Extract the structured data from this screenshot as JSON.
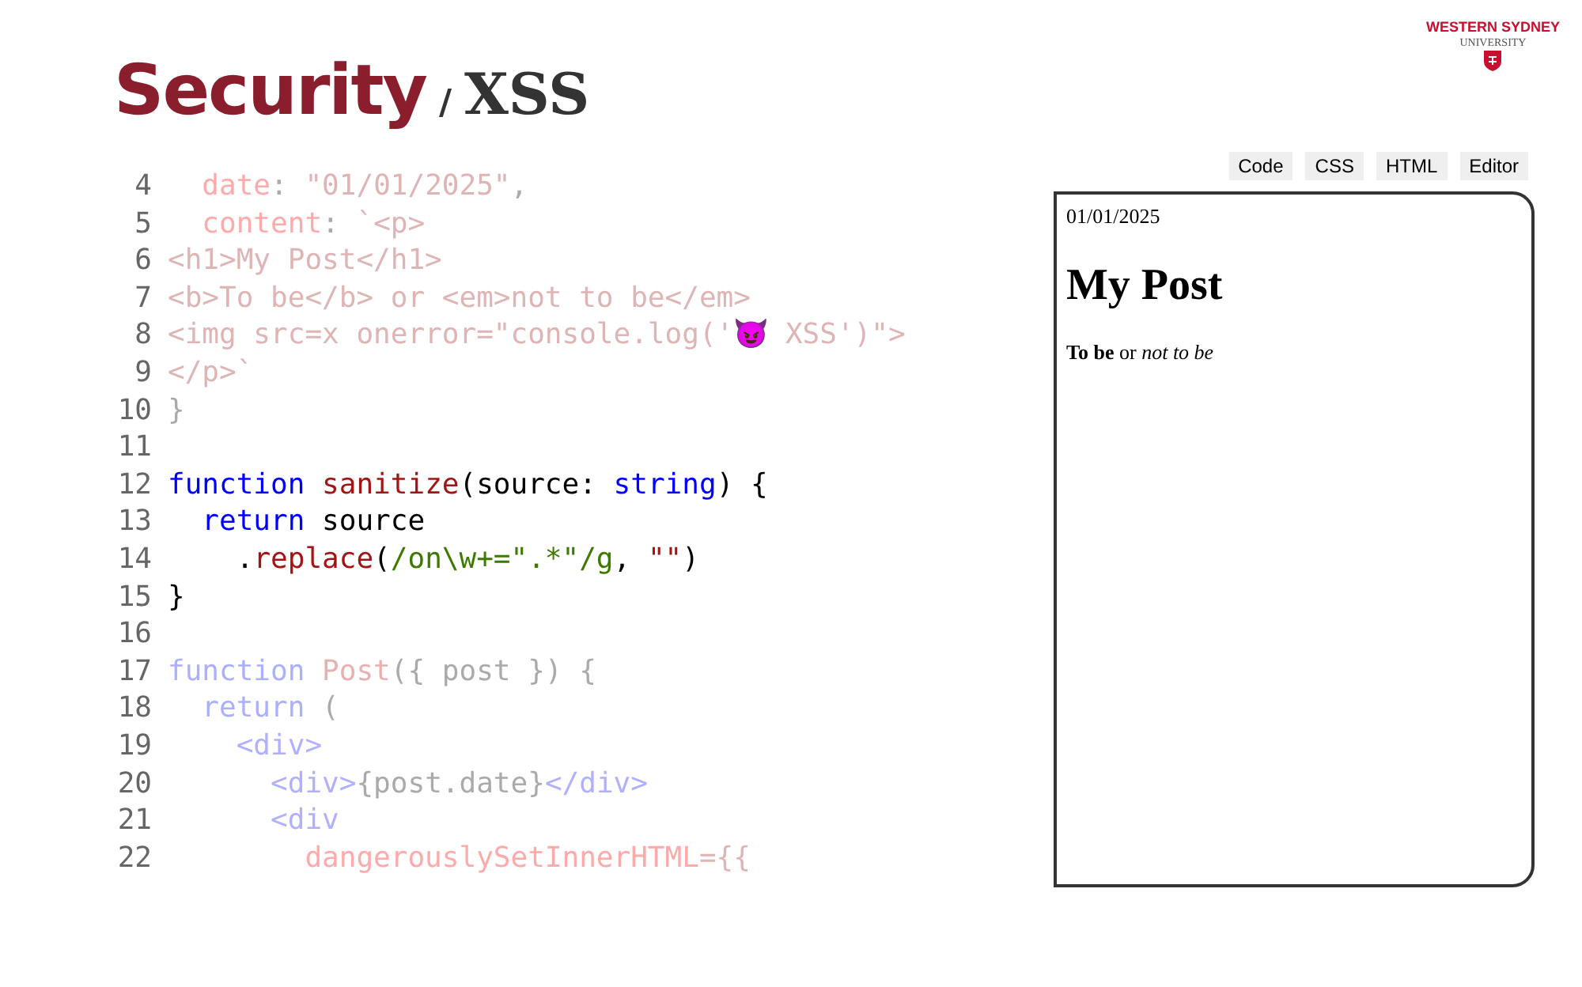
{
  "logo": {
    "line1": "WESTERN SYDNEY",
    "line2": "UNIVERSITY"
  },
  "title": {
    "main": "Security",
    "separator": "/",
    "sub": "XSS"
  },
  "code": {
    "lines": [
      {
        "number": "4",
        "dimmed": true,
        "tokens": [
          {
            "text": "  date",
            "kind": "prop"
          },
          {
            "text": ": ",
            "kind": "plain"
          },
          {
            "text": "\"01/01/2025\"",
            "kind": "template"
          },
          {
            "text": ",",
            "kind": "plain"
          }
        ]
      },
      {
        "number": "5",
        "dimmed": true,
        "tokens": [
          {
            "text": "  content",
            "kind": "prop"
          },
          {
            "text": ": ",
            "kind": "plain"
          },
          {
            "text": "`<p>",
            "kind": "template"
          }
        ]
      },
      {
        "number": "6",
        "dimmed": true,
        "tokens": [
          {
            "text": "<h1>My Post</h1>",
            "kind": "template"
          }
        ]
      },
      {
        "number": "7",
        "dimmed": true,
        "tokens": [
          {
            "text": "<b>To be</b> or <em>not to be</em>",
            "kind": "template"
          }
        ]
      },
      {
        "number": "8",
        "dimmed": true,
        "tokens": [
          {
            "text": "<img src=x onerror=\"console.log('😈 XSS')\">",
            "kind": "template"
          }
        ]
      },
      {
        "number": "9",
        "dimmed": true,
        "tokens": [
          {
            "text": "</p>`",
            "kind": "template"
          }
        ]
      },
      {
        "number": "10",
        "dimmed": true,
        "tokens": [
          {
            "text": "}",
            "kind": "plain"
          }
        ]
      },
      {
        "number": "11"
      },
      {
        "number": "12",
        "dimmed": false,
        "tokens": [
          {
            "text": "function ",
            "kind": "keyword"
          },
          {
            "text": "sanitize",
            "kind": "fn"
          },
          {
            "text": "(source: ",
            "kind": "plain"
          },
          {
            "text": "string",
            "kind": "keyword"
          },
          {
            "text": ") {",
            "kind": "plain"
          }
        ]
      },
      {
        "number": "13",
        "dimmed": false,
        "tokens": [
          {
            "text": "  return",
            "kind": "keyword"
          },
          {
            "text": " source",
            "kind": "plain"
          }
        ]
      },
      {
        "number": "14",
        "dimmed": false,
        "tokens": [
          {
            "text": "    .",
            "kind": "plain"
          },
          {
            "text": "replace",
            "kind": "fn"
          },
          {
            "text": "(",
            "kind": "plain"
          },
          {
            "text": "/on\\w+=\".*\"/g",
            "kind": "regex"
          },
          {
            "text": ", ",
            "kind": "plain"
          },
          {
            "text": "\"\"",
            "kind": "string"
          },
          {
            "text": ")",
            "kind": "plain"
          }
        ]
      },
      {
        "number": "15",
        "dimmed": false,
        "tokens": [
          {
            "text": "}",
            "kind": "plain"
          }
        ]
      },
      {
        "number": "16"
      },
      {
        "number": "17",
        "dimmed": true,
        "tokens": [
          {
            "text": "function ",
            "kind": "keyword"
          },
          {
            "text": "Post",
            "kind": "fn"
          },
          {
            "text": "({ post }) {",
            "kind": "plain"
          }
        ]
      },
      {
        "number": "18",
        "dimmed": true,
        "tokens": [
          {
            "text": "  return",
            "kind": "keyword"
          },
          {
            "text": " (",
            "kind": "plain"
          }
        ]
      },
      {
        "number": "19",
        "dimmed": true,
        "tokens": [
          {
            "text": "    <div>",
            "kind": "tag"
          }
        ]
      },
      {
        "number": "20",
        "dimmed": true,
        "tokens": [
          {
            "text": "      <div>",
            "kind": "tag"
          },
          {
            "text": "{post.date}",
            "kind": "plain"
          },
          {
            "text": "</div>",
            "kind": "tag"
          }
        ]
      },
      {
        "number": "21",
        "dimmed": true,
        "tokens": [
          {
            "text": "      <div",
            "kind": "tag"
          }
        ]
      },
      {
        "number": "22",
        "dimmed": true,
        "tokens": [
          {
            "text": "        dangerouslySetInnerHTML",
            "kind": "prop"
          },
          {
            "text": "={{",
            "kind": "template"
          }
        ]
      }
    ]
  },
  "tabs": [
    {
      "label": "Code",
      "selected": false
    },
    {
      "label": "CSS",
      "selected": false
    },
    {
      "label": "HTML",
      "selected": false
    },
    {
      "label": "Editor",
      "selected": false
    }
  ],
  "preview": {
    "date": "01/01/2025",
    "heading": "My Post",
    "body": "**To be** or *not to be*"
  }
}
